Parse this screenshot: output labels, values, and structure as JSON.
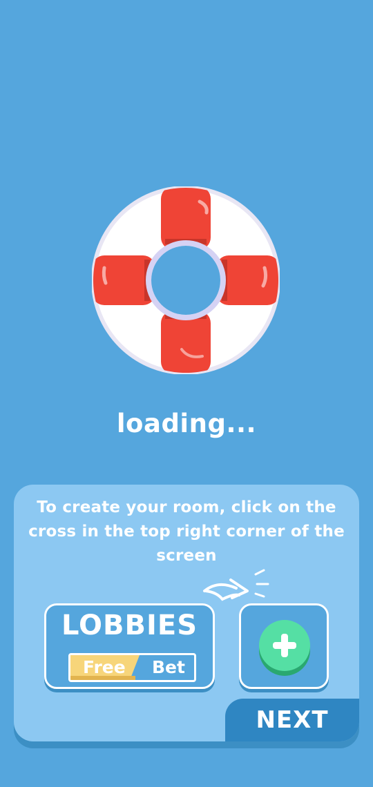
{
  "loading": {
    "text": "loading..."
  },
  "tutorial": {
    "tip": "To create your room, click on the cross in the top right corner of the screen",
    "lobbies": {
      "title": "LOBBIES",
      "toggle_free": "Free",
      "toggle_bet": "Bet"
    },
    "next_label": "NEXT"
  },
  "icons": {
    "hero": "lifebuoy-icon",
    "pointer": "curved-arrow-icon",
    "add": "plus-icon"
  },
  "colors": {
    "background": "#55a6dd",
    "card": "#8cc8f2",
    "lifebuoy_red": "#ef4436",
    "add_green": "#55dfa4",
    "free_yellow": "#f7d57a",
    "next_blue": "#2f86c2"
  }
}
